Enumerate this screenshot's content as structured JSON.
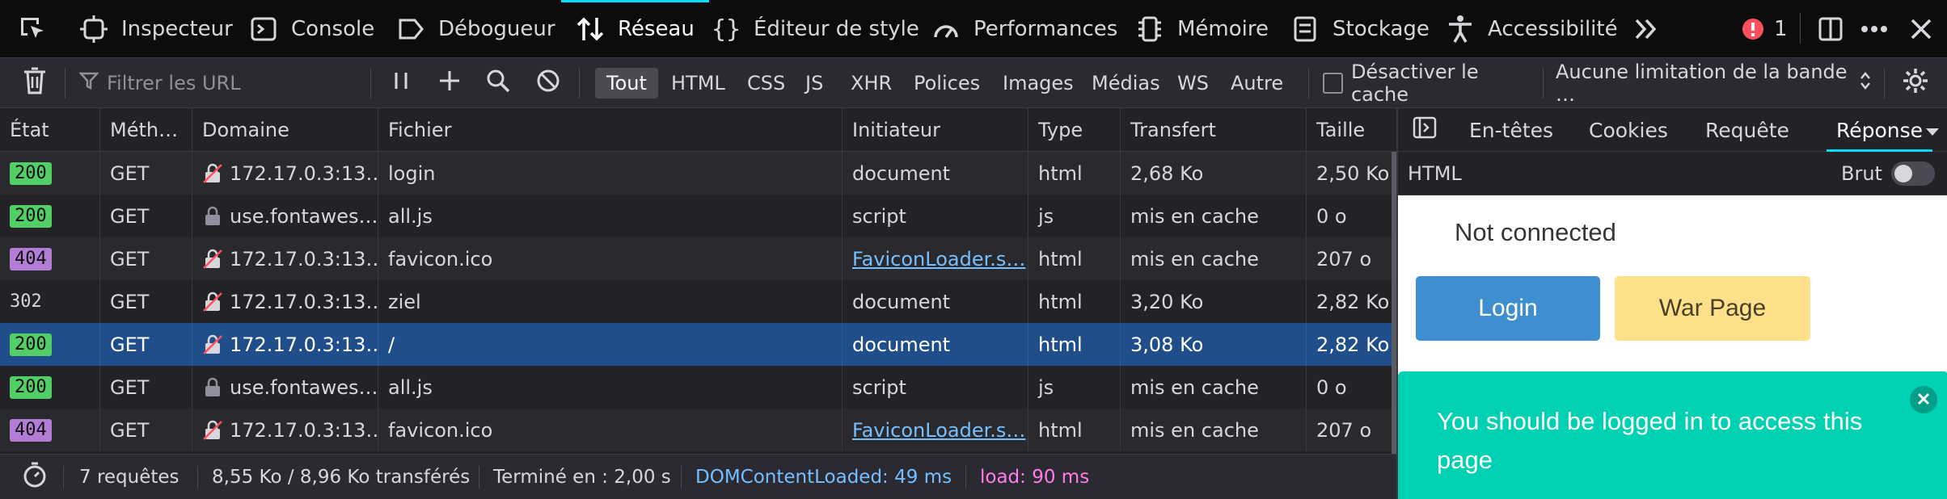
{
  "toolbox": {
    "tabs": [
      {
        "label": "Inspecteur",
        "icon": "inspector-icon"
      },
      {
        "label": "Console",
        "icon": "console-icon"
      },
      {
        "label": "Débogueur",
        "icon": "debugger-icon"
      },
      {
        "label": "Réseau",
        "icon": "network-icon",
        "active": true
      },
      {
        "label": "Éditeur de style",
        "icon": "style-editor-icon"
      },
      {
        "label": "Performances",
        "icon": "performance-icon"
      },
      {
        "label": "Mémoire",
        "icon": "memory-icon"
      },
      {
        "label": "Stockage",
        "icon": "storage-icon"
      },
      {
        "label": "Accessibilité",
        "icon": "accessibility-icon"
      }
    ],
    "error_count": "1"
  },
  "toolbar": {
    "filter_placeholder": "Filtrer les URL",
    "types": [
      "Tout",
      "HTML",
      "CSS",
      "JS",
      "XHR",
      "Polices",
      "Images",
      "Médias",
      "WS",
      "Autre"
    ],
    "active_type": "Tout",
    "disable_cache_label": "Désactiver le cache",
    "throttling_label": "Aucune limitation de la bande …"
  },
  "columns": [
    "État",
    "Méth…",
    "Domaine",
    "Fichier",
    "Initiateur",
    "Type",
    "Transfert",
    "Taille"
  ],
  "requests": [
    {
      "status": "200",
      "method": "GET",
      "domain": "172.17.0.3:13…",
      "secure": false,
      "file": "login",
      "initiator": "document",
      "initiator_link": false,
      "type": "html",
      "transfer": "2,68 Ko",
      "size": "2,50 Ko"
    },
    {
      "status": "200",
      "method": "GET",
      "domain": "use.fontawes…",
      "secure": true,
      "file": "all.js",
      "initiator": "script",
      "initiator_link": false,
      "type": "js",
      "transfer": "mis en cache",
      "size": "0 o"
    },
    {
      "status": "404",
      "method": "GET",
      "domain": "172.17.0.3:13…",
      "secure": false,
      "file": "favicon.ico",
      "initiator": "FaviconLoader.s…",
      "initiator_link": true,
      "type": "html",
      "transfer": "mis en cache",
      "size": "207 o"
    },
    {
      "status": "302",
      "method": "GET",
      "domain": "172.17.0.3:13…",
      "secure": false,
      "file": "ziel",
      "initiator": "document",
      "initiator_link": false,
      "type": "html",
      "transfer": "3,20 Ko",
      "size": "2,82 Ko"
    },
    {
      "status": "200",
      "method": "GET",
      "domain": "172.17.0.3:13…",
      "secure": false,
      "file": "/",
      "initiator": "document",
      "initiator_link": false,
      "type": "html",
      "transfer": "3,08 Ko",
      "size": "2,82 Ko",
      "selected": true
    },
    {
      "status": "200",
      "method": "GET",
      "domain": "use.fontawes…",
      "secure": true,
      "file": "all.js",
      "initiator": "script",
      "initiator_link": false,
      "type": "js",
      "transfer": "mis en cache",
      "size": "0 o"
    },
    {
      "status": "404",
      "method": "GET",
      "domain": "172.17.0.3:13…",
      "secure": false,
      "file": "favicon.ico",
      "initiator": "FaviconLoader.s…",
      "initiator_link": true,
      "type": "html",
      "transfer": "mis en cache",
      "size": "207 o"
    }
  ],
  "statusbar": {
    "requests": "7 requêtes",
    "transferred": "8,55 Ko / 8,96 Ko transférés",
    "finished": "Terminé en : 2,00 s",
    "dom_content_loaded": "DOMContentLoaded: 49 ms",
    "load": "load: 90 ms"
  },
  "side_panel": {
    "tabs": [
      "En-têtes",
      "Cookies",
      "Requête",
      "Réponse"
    ],
    "active_tab": "Réponse",
    "sub_label": "HTML",
    "raw_label": "Brut",
    "preview": {
      "text": "Not connected",
      "login_button": "Login",
      "war_button": "War Page",
      "toast": "You should be logged in to access this page"
    }
  },
  "colors": {
    "accent": "#00ddff",
    "selected_row": "#204e8a",
    "status_200": "#51cf66",
    "status_404": "#b37dd6",
    "login_button": "#3e8ed0",
    "war_button": "#ffe08a",
    "toast": "#00d1b2",
    "dom_content_loaded": "#75bfff",
    "load": "#ff7de9"
  }
}
